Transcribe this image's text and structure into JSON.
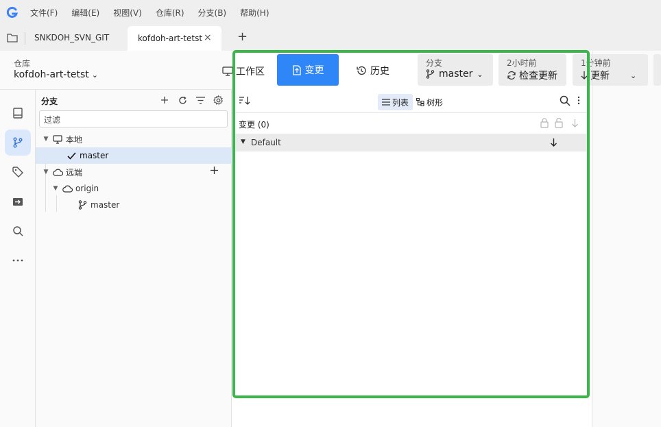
{
  "menu": [
    "文件(F)",
    "编辑(E)",
    "视图(V)",
    "仓库(R)",
    "分支(B)",
    "帮助(H)"
  ],
  "tabs": [
    {
      "label": "SNKDOH_SVN_GIT",
      "active": false
    },
    {
      "label": "kofdoh-art-tetst",
      "active": true
    }
  ],
  "tab_add": "+",
  "tab_close": "×",
  "repo": {
    "label": "仓库",
    "name": "kofdoh-art-tetst"
  },
  "toolbar": {
    "workspace_label": "工作区",
    "changes_label": "变更",
    "history_label": "历史",
    "branch": {
      "label": "分支",
      "value": "master"
    },
    "fetch": {
      "label": "2小时前",
      "value": "检查更新"
    },
    "pull": {
      "label": "1分钟前",
      "value": "更新"
    }
  },
  "branches_panel": {
    "title": "分支",
    "filter_placeholder": "过滤",
    "local_label": "本地",
    "local_branch": "master",
    "remote_label": "远端",
    "remote_name": "origin",
    "remote_branch": "master"
  },
  "changes_view": {
    "list_label": "列表",
    "tree_label": "树形",
    "changes_count_label": "变更 (0)",
    "group_label": "Default"
  },
  "colors": {
    "accent": "#2f86f6",
    "selection": "#dce7f8",
    "highlight_frame": "#3cb54a"
  }
}
